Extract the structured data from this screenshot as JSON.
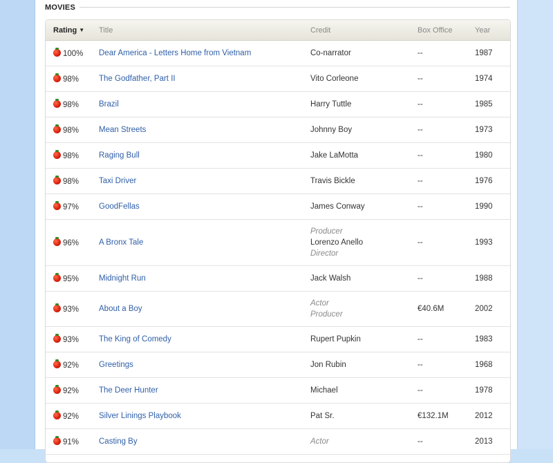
{
  "section": {
    "title": "MOVIES"
  },
  "columns": {
    "rating": "Rating",
    "title": "Title",
    "credit": "Credit",
    "box_office": "Box Office",
    "year": "Year"
  },
  "rows": [
    {
      "rating": "100%",
      "title": "Dear America - Letters Home from Vietnam",
      "credit_pre": "",
      "credit": "Co-narrator",
      "credit_post": "",
      "box": "--",
      "year": "1987"
    },
    {
      "rating": "98%",
      "title": "The Godfather, Part II",
      "credit_pre": "",
      "credit": "Vito Corleone",
      "credit_post": "",
      "box": "--",
      "year": "1974"
    },
    {
      "rating": "98%",
      "title": "Brazil",
      "credit_pre": "",
      "credit": "Harry Tuttle",
      "credit_post": "",
      "box": "--",
      "year": "1985"
    },
    {
      "rating": "98%",
      "title": "Mean Streets",
      "credit_pre": "",
      "credit": "Johnny Boy",
      "credit_post": "",
      "box": "--",
      "year": "1973"
    },
    {
      "rating": "98%",
      "title": "Raging Bull",
      "credit_pre": "",
      "credit": "Jake LaMotta",
      "credit_post": "",
      "box": "--",
      "year": "1980"
    },
    {
      "rating": "98%",
      "title": "Taxi Driver",
      "credit_pre": "",
      "credit": "Travis Bickle",
      "credit_post": "",
      "box": "--",
      "year": "1976"
    },
    {
      "rating": "97%",
      "title": "GoodFellas",
      "credit_pre": "",
      "credit": "James Conway",
      "credit_post": "",
      "box": "--",
      "year": "1990"
    },
    {
      "rating": "96%",
      "title": "A Bronx Tale",
      "credit_pre": "Producer",
      "credit": "Lorenzo Anello",
      "credit_post": "Director",
      "box": "--",
      "year": "1993"
    },
    {
      "rating": "95%",
      "title": "Midnight Run",
      "credit_pre": "",
      "credit": "Jack Walsh",
      "credit_post": "",
      "box": "--",
      "year": "1988"
    },
    {
      "rating": "93%",
      "title": "About a Boy",
      "credit_pre": "Actor",
      "credit": "",
      "credit_post": "Producer",
      "box": "€40.6M",
      "year": "2002"
    },
    {
      "rating": "93%",
      "title": "The King of Comedy",
      "credit_pre": "",
      "credit": "Rupert Pupkin",
      "credit_post": "",
      "box": "--",
      "year": "1983"
    },
    {
      "rating": "92%",
      "title": "Greetings",
      "credit_pre": "",
      "credit": "Jon Rubin",
      "credit_post": "",
      "box": "--",
      "year": "1968"
    },
    {
      "rating": "92%",
      "title": "The Deer Hunter",
      "credit_pre": "",
      "credit": "Michael",
      "credit_post": "",
      "box": "--",
      "year": "1978"
    },
    {
      "rating": "92%",
      "title": "Silver Linings Playbook",
      "credit_pre": "",
      "credit": "Pat Sr.",
      "credit_post": "",
      "box": "€132.1M",
      "year": "2012"
    },
    {
      "rating": "91%",
      "title": "Casting By",
      "credit_pre": "Actor",
      "credit": "",
      "credit_post": "",
      "box": "--",
      "year": "2013"
    }
  ]
}
